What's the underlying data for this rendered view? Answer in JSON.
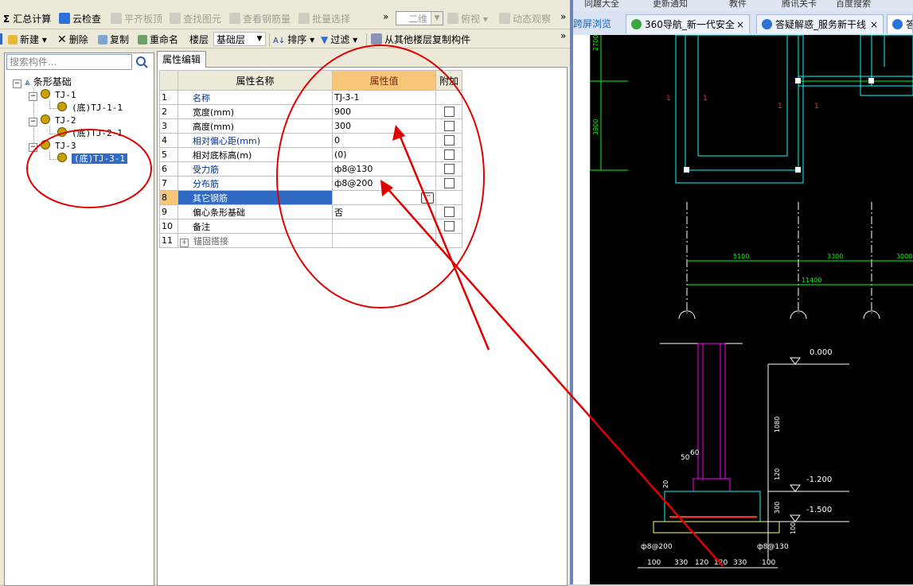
{
  "toolbar1": {
    "sum": "汇总计算",
    "cloud_check": "云检查",
    "level_slab": "平齐板顶",
    "find_element": "查找图元",
    "view_rebar": "查看钢筋量",
    "batch_select": "批量选择",
    "more": "»",
    "view_mode": "二维",
    "top_view": "俯视",
    "dynamic_observe": "动态观察"
  },
  "toolbar2": {
    "new": "新建",
    "delete": "删除",
    "copy": "复制",
    "rename": "重命名",
    "floor_label": "楼层",
    "floor_value": "基础层",
    "sort": "排序",
    "filter": "过滤",
    "copy_from_floor": "从其他楼层复制构件",
    "more": "»"
  },
  "tree": {
    "search_placeholder": "搜索构件...",
    "root": "条形基础",
    "items": [
      {
        "label": "TJ-1",
        "child": "(底)TJ-1-1"
      },
      {
        "label": "TJ-2",
        "child": "(底)TJ-2-1"
      },
      {
        "label": "TJ-3",
        "child": "(底)TJ-3-1"
      }
    ]
  },
  "props": {
    "tab": "属性编辑",
    "headers": {
      "name": "属性名称",
      "value": "属性值",
      "extra": "附加"
    },
    "rows": [
      {
        "no": "1",
        "name": "名称",
        "value": "TJ-3-1"
      },
      {
        "no": "2",
        "name": "宽度(mm)",
        "value": "900"
      },
      {
        "no": "3",
        "name": "高度(mm)",
        "value": "300"
      },
      {
        "no": "4",
        "name": "相对偏心距(mm)",
        "value": "0"
      },
      {
        "no": "5",
        "name": "相对底标高(m)",
        "value": "(0)"
      },
      {
        "no": "6",
        "name": "受力筋",
        "value": "ф8@130"
      },
      {
        "no": "7",
        "name": "分布筋",
        "value": "ф8@200"
      },
      {
        "no": "8",
        "name": "其它钢筋",
        "value": ""
      },
      {
        "no": "9",
        "name": "偏心条形基础",
        "value": "否"
      },
      {
        "no": "10",
        "name": "备注",
        "value": ""
      },
      {
        "no": "11",
        "name": "锚固搭接",
        "value": ""
      }
    ]
  },
  "browser": {
    "top_items": [
      "同趣大全",
      "更新通知",
      "教件",
      "腾讯关卡",
      "百度搜索"
    ],
    "tabs": [
      "跨屏浏览",
      "360导航_新一代安全",
      "答疑解惑_服务新干线",
      "答"
    ]
  },
  "cad": {
    "labels_left": [
      "2700",
      "3900"
    ],
    "dim_top": [
      "5100",
      "3300",
      "3000"
    ],
    "dim_total": "11400",
    "elev": [
      "0.000",
      "-1.200",
      "-1.500"
    ],
    "vert_dims": [
      "1080",
      "120",
      "300",
      "100"
    ],
    "rebar": [
      "ф8@200",
      "ф8@130"
    ],
    "bottom_dims": [
      "100",
      "330",
      "120",
      "120",
      "330",
      "100"
    ],
    "small": [
      "50",
      "60",
      "20"
    ],
    "marks": [
      "1",
      "1",
      "1",
      "1"
    ]
  }
}
